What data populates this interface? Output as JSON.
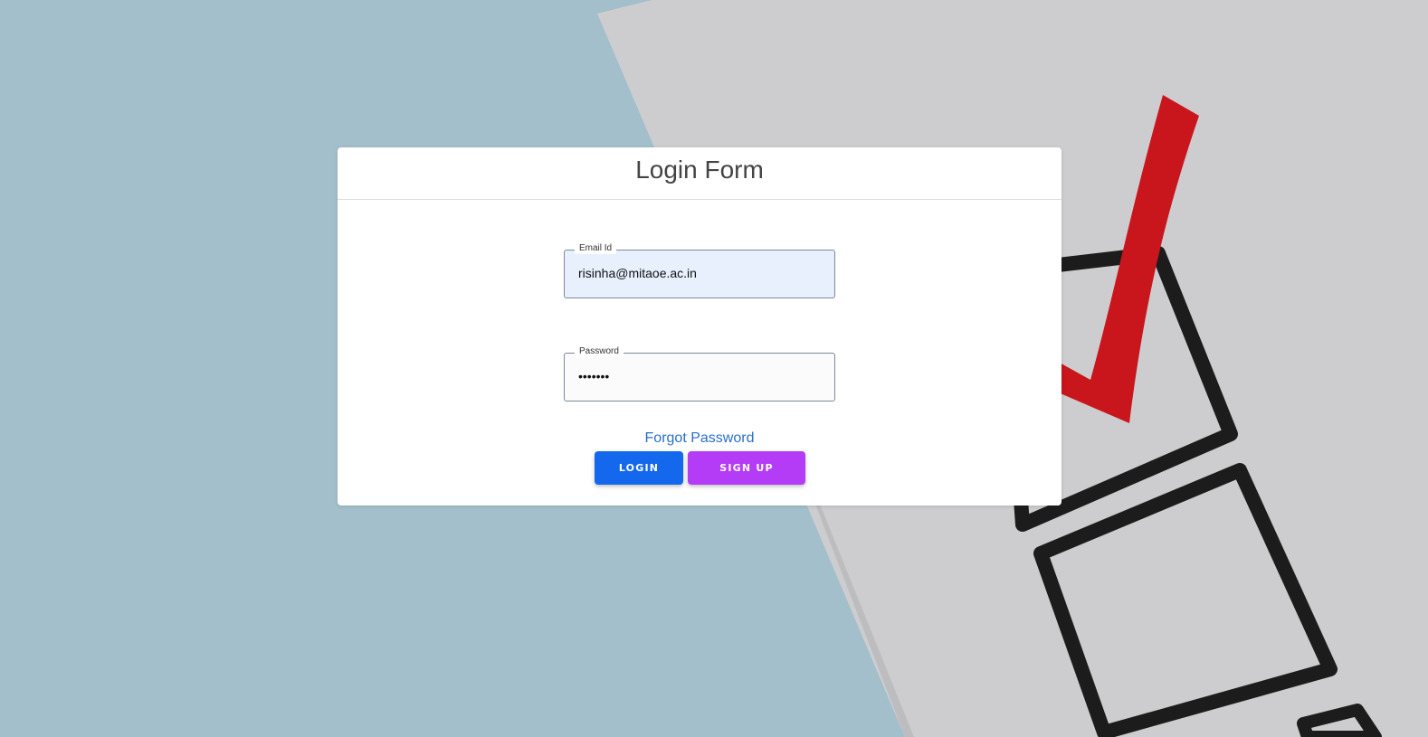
{
  "login_form": {
    "title": "Login Form",
    "email": {
      "label": "Email Id",
      "value": "risinha@mitaoe.ac.in"
    },
    "password": {
      "label": "Password",
      "value": "•••••••"
    },
    "forgot_password": "Forgot Password",
    "login_button": "LOGIN",
    "signup_button": "SIGN UP"
  },
  "colors": {
    "background": "#a2bfcb",
    "login_button": "#1468ee",
    "signup_button": "#b53cf6",
    "link": "#2a6fc9",
    "checkmark": "#c8161c"
  },
  "icons": {
    "background_illustration": "checklist-checkmark-illustration"
  }
}
